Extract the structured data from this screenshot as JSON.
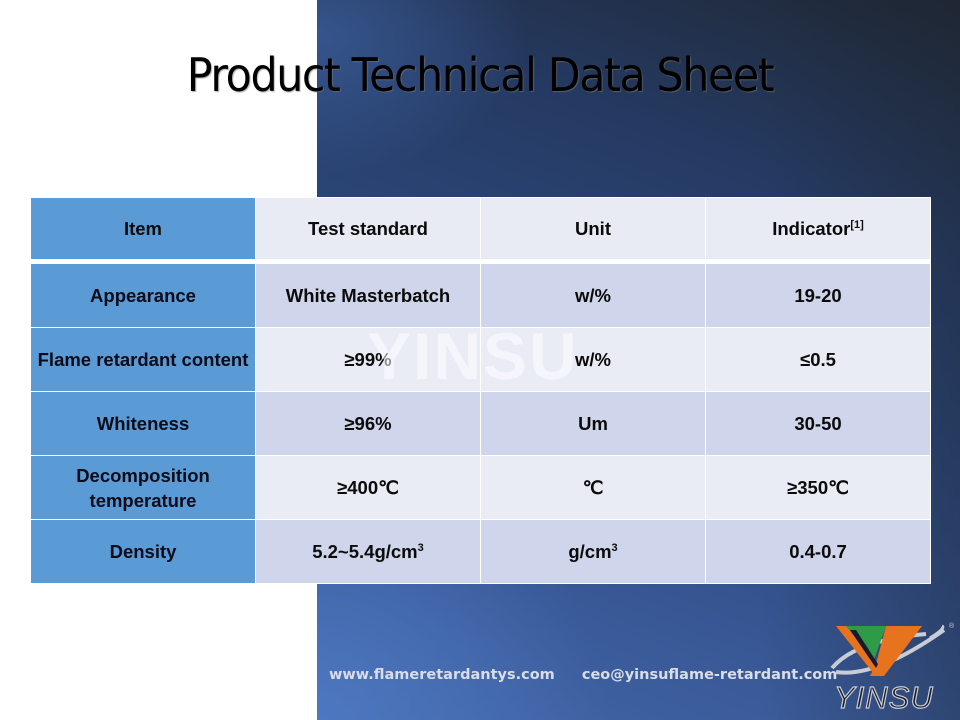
{
  "title": "Product Technical Data Sheet",
  "watermark": "YINSU",
  "table": {
    "headers": [
      "Item",
      "Test standard",
      "Unit",
      "Indicator"
    ],
    "header_footnote": "[1]",
    "rows": [
      {
        "item": "Appearance",
        "standard": "White Masterbatch",
        "unit": "w/%",
        "indicator": "19-20"
      },
      {
        "item": "Flame retardant content",
        "standard": "≥99%",
        "unit": "w/%",
        "indicator": "≤0.5"
      },
      {
        "item": "Whiteness",
        "standard": "≥96%",
        "unit": "Um",
        "indicator": "30-50"
      },
      {
        "item": "Decomposition temperature",
        "standard": "≥400℃",
        "unit": "℃",
        "indicator": "≥350℃"
      },
      {
        "item": "Density",
        "standard": "5.2~5.4g/cm",
        "standard_sup": "3",
        "unit": "g/cm",
        "unit_sup": "3",
        "indicator": "0.4-0.7"
      }
    ]
  },
  "footer": {
    "website": "www.flameretardantys.com",
    "email": "ceo@yinsuflame-retardant.com"
  },
  "logo": {
    "text": "YINSU",
    "registered_mark": "®",
    "colors": {
      "green": "#2e9b48",
      "orange": "#e8731f",
      "silver": "#c8ccd4"
    }
  },
  "colors": {
    "item_column": "#5b9bd5",
    "row_dark": "#cfd5ea",
    "row_light": "#e9ebf5"
  }
}
